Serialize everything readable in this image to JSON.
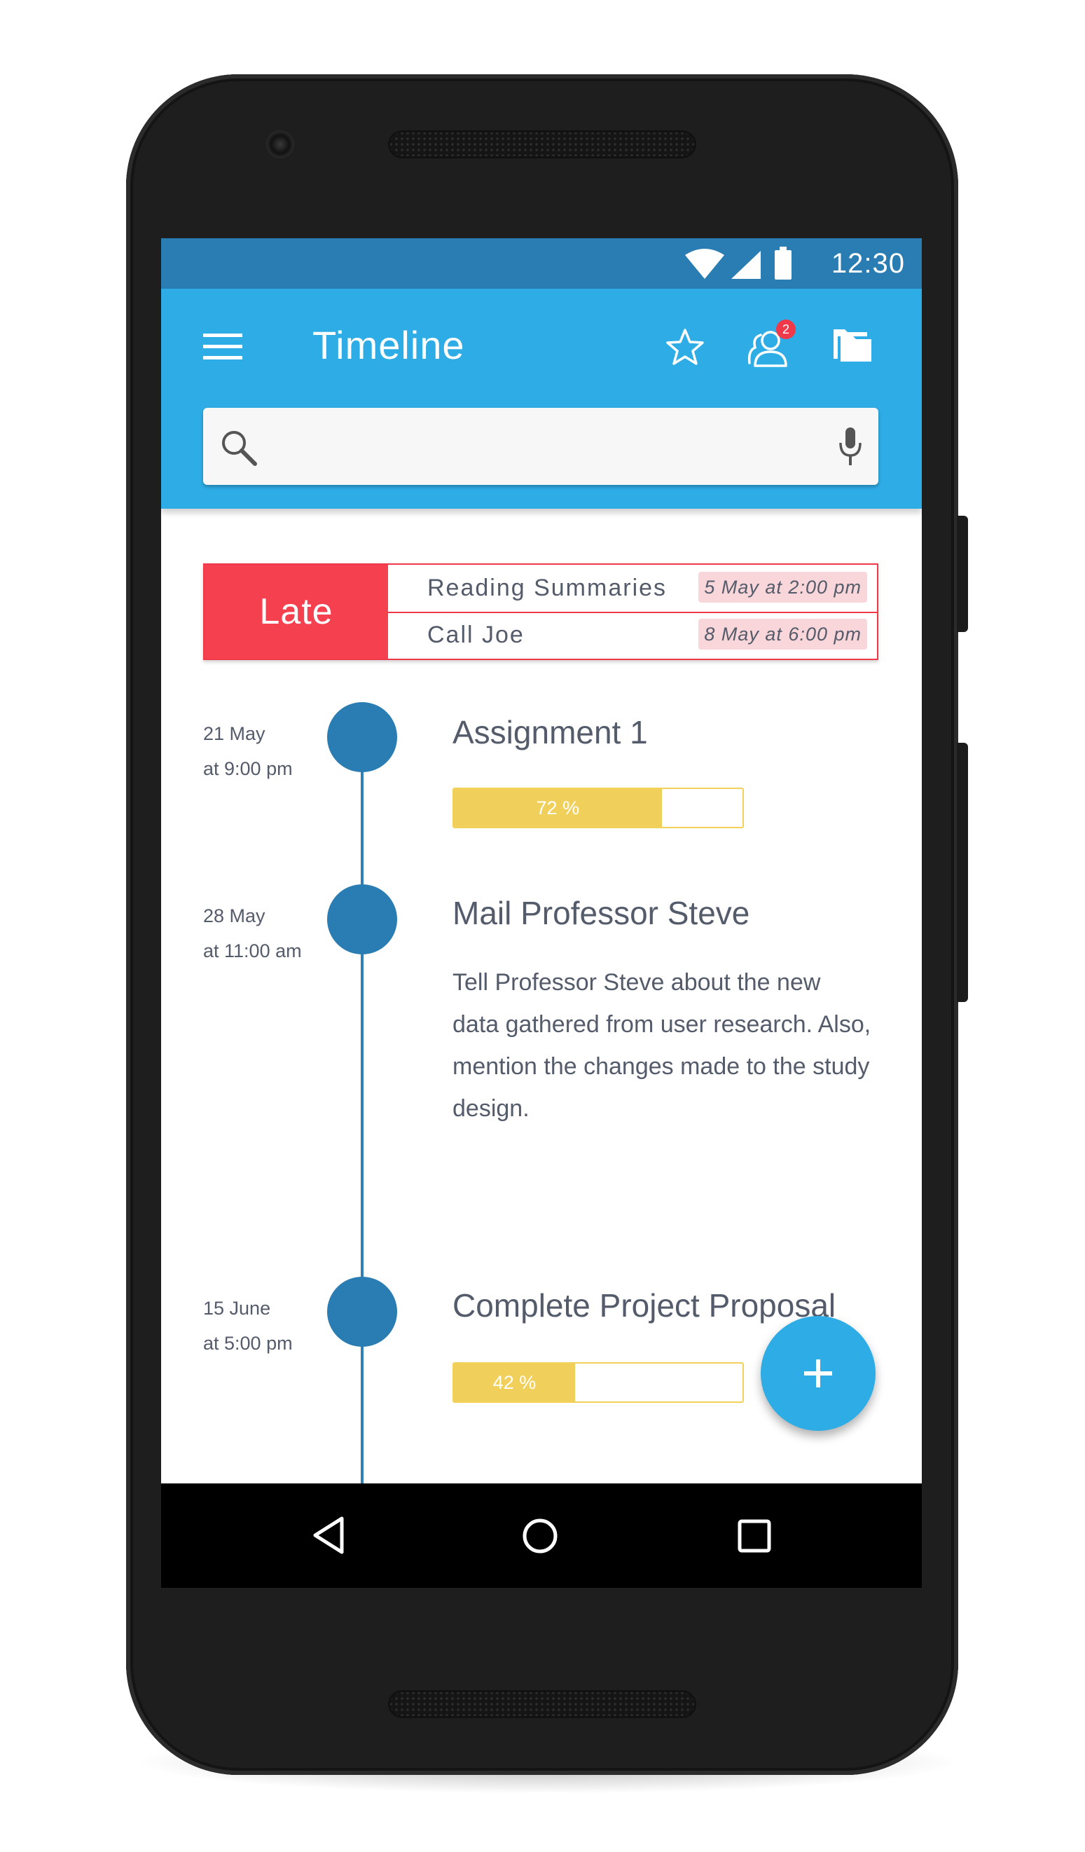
{
  "status_bar": {
    "time": "12:30"
  },
  "app_bar": {
    "title": "Timeline",
    "menu_icon": "hamburger-menu-icon",
    "actions": [
      "star-icon",
      "people-icon",
      "folder-icon"
    ],
    "notification_count": "2"
  },
  "search": {
    "placeholder": "",
    "value": "",
    "search_icon": "magnifier-icon",
    "mic_icon": "microphone-icon"
  },
  "late_card": {
    "label": "Late",
    "items": [
      {
        "title": "Reading Summaries",
        "date": "5 May at 2:00 pm"
      },
      {
        "title": "Call Joe",
        "date": "8 May at 6:00 pm"
      }
    ]
  },
  "timeline": [
    {
      "date_line1": "21 May",
      "date_line2": "at 9:00 pm",
      "title": "Assignment 1",
      "progress": 72,
      "progress_label": "72 %"
    },
    {
      "date_line1": "28 May",
      "date_line2": "at 11:00 am",
      "title": "Mail Professor Steve",
      "description": "Tell Professor Steve about the new data gathered from user research. Also, mention the changes made to the study design."
    },
    {
      "date_line1": "15 June",
      "date_line2": "at 5:00 pm",
      "title": "Complete Project Proposal",
      "progress": 42,
      "progress_label": "42 %"
    }
  ],
  "fab": {
    "icon": "plus-icon"
  },
  "nav_bar": {
    "buttons": [
      "back-icon",
      "home-icon",
      "recents-icon"
    ]
  },
  "colors": {
    "status_bar": "#2a7db3",
    "app_bar": "#2eace5",
    "late_red": "#f5414f",
    "timeline_dot": "#2a7db3",
    "progress_yellow": "#f0d05a",
    "text": "#545b6a"
  }
}
